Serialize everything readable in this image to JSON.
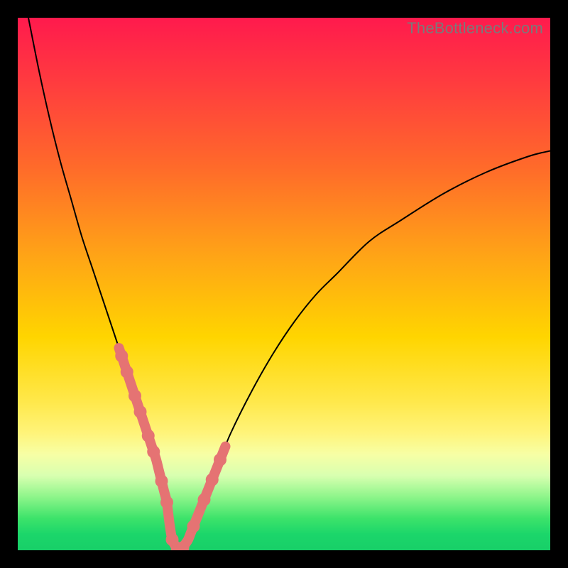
{
  "watermark": "TheBottleneck.com",
  "colors": {
    "frame": "#000000",
    "curve": "#000000",
    "beads": "#e57373",
    "gradient_top": "#ff1a4d",
    "gradient_mid": "#ffd500",
    "gradient_bottom": "#18cf68"
  },
  "chart_data": {
    "type": "line",
    "title": "",
    "xlabel": "",
    "ylabel": "",
    "xlim": [
      0,
      100
    ],
    "ylim": [
      0,
      100
    ],
    "grid": false,
    "legend": false,
    "series": [
      {
        "name": "bottleneck-curve",
        "x": [
          2,
          4,
          6,
          8,
          10,
          12,
          14,
          16,
          18,
          20,
          22,
          24,
          26,
          27,
          28,
          28.5,
          29,
          30,
          31,
          32,
          34,
          36,
          38,
          40,
          44,
          48,
          52,
          56,
          60,
          66,
          72,
          80,
          88,
          96,
          100
        ],
        "y": [
          100,
          90,
          81,
          73,
          66,
          59,
          53,
          47,
          41,
          35,
          29,
          23,
          17,
          13,
          9,
          5,
          2,
          0,
          0.5,
          2,
          7,
          12,
          17,
          22,
          30,
          37,
          43,
          48,
          52,
          58,
          62,
          67,
          71,
          74,
          75
        ]
      }
    ],
    "annotations": {
      "bead_segment_x_range": [
        19,
        39
      ],
      "bead_positions_x": [
        19.5,
        20.5,
        22,
        23,
        24.5,
        25.5,
        27,
        28,
        29,
        30,
        31,
        33,
        35,
        36.5,
        38
      ]
    }
  }
}
